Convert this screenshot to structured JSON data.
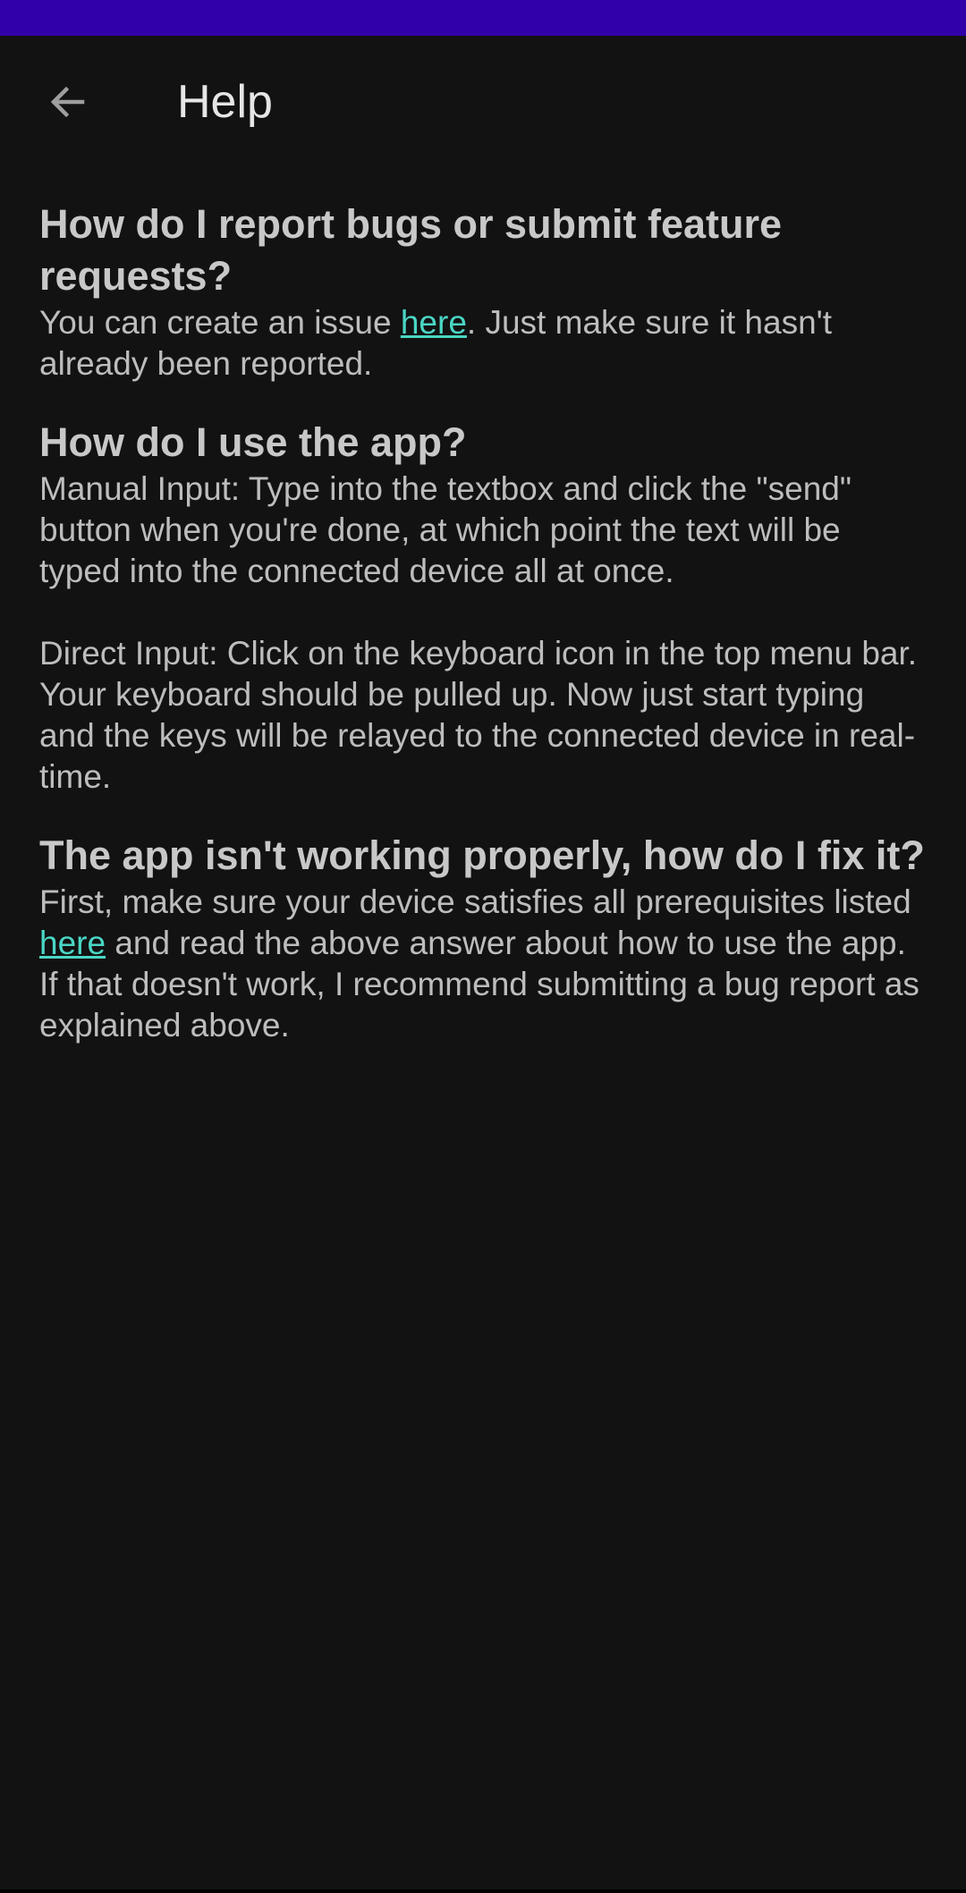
{
  "colors": {
    "status_bar": "#3200a8",
    "background": "#121212",
    "link": "#4ad6c4"
  },
  "app_bar": {
    "back_icon": "arrow-left-icon",
    "title": "Help"
  },
  "faq": [
    {
      "question": "How do I report bugs or submit feature requests?",
      "answer": {
        "before_link": "You can create an issue ",
        "link_text": "here",
        "after_link": ". Just make sure it hasn't already been reported."
      }
    },
    {
      "question": "How do I use the app?",
      "paragraphs": [
        "Manual Input: Type into the textbox and click the \"send\" button when you're done, at which point the text will be typed into the connected device all at once.",
        "Direct Input: Click on the keyboard icon in the top menu bar. Your keyboard should be pulled up. Now just start typing and the keys will be relayed to the connected device in real-time."
      ]
    },
    {
      "question": "The app isn't working properly, how do I fix it?",
      "answer": {
        "before_link": "First, make sure your device satisfies all prerequisites listed ",
        "link_text": "here",
        "after_link": " and read the above answer about how to use the app. If that doesn't work, I recommend submitting a bug report as explained above."
      }
    }
  ]
}
